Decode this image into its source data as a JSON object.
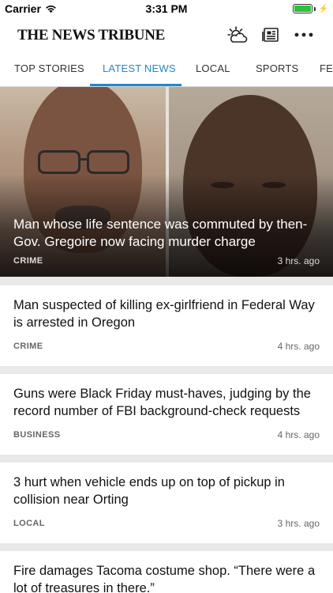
{
  "status_bar": {
    "carrier": "Carrier",
    "time": "3:31 PM"
  },
  "header": {
    "title": "THE NEWS TRIBUNE",
    "icons": [
      "weather-icon",
      "e-edition-icon",
      "more-icon"
    ]
  },
  "tabs": [
    {
      "label": "TOP STORIES",
      "active": false
    },
    {
      "label": "LATEST NEWS",
      "active": true
    },
    {
      "label": "LOCAL",
      "active": false
    },
    {
      "label": "SPORTS",
      "active": false
    },
    {
      "label": "FEA",
      "active": false
    }
  ],
  "hero": {
    "headline": "Man whose life sentence was commuted by then-Gov. Gregoire now facing murder charge",
    "category": "CRIME",
    "time": "3 hrs. ago"
  },
  "articles": [
    {
      "headline": "Man suspected of killing ex-girlfriend in Federal Way is arrested in Oregon",
      "category": "CRIME",
      "time": "4 hrs. ago"
    },
    {
      "headline": "Guns were Black Friday must-haves, judging by the record number of FBI background-check requests",
      "category": "BUSINESS",
      "time": "4 hrs. ago"
    },
    {
      "headline": "3 hurt when vehicle ends up on top of pickup in collision near Orting",
      "category": "LOCAL",
      "time": "3 hrs. ago"
    },
    {
      "headline": "Fire damages Tacoma costume shop. “There were a lot of treasures in there.”",
      "category": "",
      "time": ""
    }
  ],
  "colors": {
    "accent": "#2189c9",
    "battery": "#2fbf3a"
  }
}
